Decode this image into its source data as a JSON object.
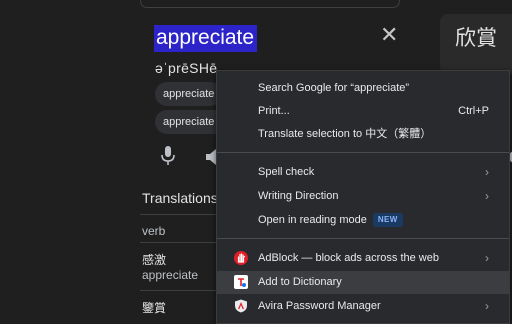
{
  "dictionary": {
    "word": "appreciate",
    "phonetic": "əˈprēSHēˌ",
    "chips": [
      "appreciate",
      "appreciate y"
    ],
    "translations_heading": "Translations",
    "part_of_speech": "verb",
    "entries": [
      {
        "zh": "感激",
        "en": "appreciate"
      },
      {
        "zh": "鑒賞",
        "en": ""
      }
    ],
    "right_card_text": "欣賞"
  },
  "context_menu": {
    "items": [
      {
        "label": "Search Google for “appreciate”"
      },
      {
        "label": "Print...",
        "shortcut": "Ctrl+P"
      },
      {
        "label": "Translate selection to 中文（繁體）"
      },
      {
        "label": "Spell check",
        "arrow": "›"
      },
      {
        "label": "Writing Direction",
        "arrow": "›"
      },
      {
        "label": "Open in reading mode",
        "badge": "NEW"
      },
      {
        "label": "AdBlock — block ads across the web",
        "arrow": "›",
        "icon": "adblock-hand-icon"
      },
      {
        "label": "Add to Dictionary",
        "icon": "dictionary-icon"
      },
      {
        "label": "Avira Password Manager",
        "arrow": "›",
        "icon": "avira-shield-icon"
      }
    ]
  },
  "colors": {
    "selection": "#2c24c8",
    "menu_bg": "#292a2d",
    "page_bg": "#1f1f1f",
    "badge_bg": "#1a3a63",
    "badge_text": "#8ab4f8",
    "adblock_red": "#e41e26"
  }
}
